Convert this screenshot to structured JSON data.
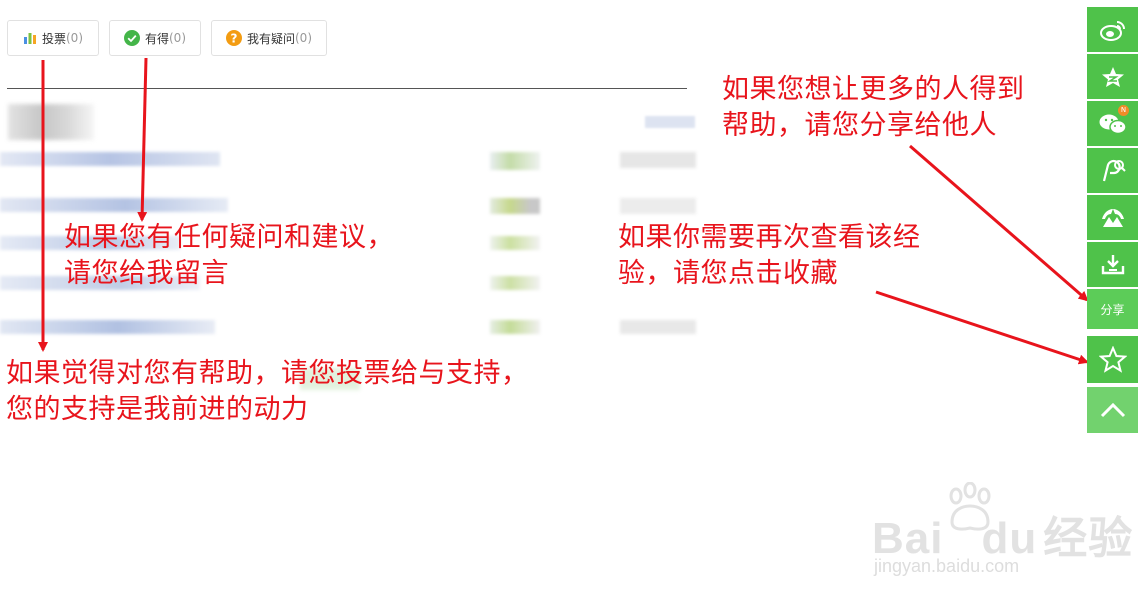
{
  "actions": {
    "vote": {
      "label": "投票",
      "count": "(0)"
    },
    "useful": {
      "label": "有得",
      "count": "(0)"
    },
    "question": {
      "label": "我有疑问",
      "count": "(0)"
    }
  },
  "annotations": {
    "comment": [
      "如果您有任何疑问和建议，",
      "请您给我留言"
    ],
    "vote": [
      "如果觉得对您有帮助，请您投票给与支持，",
      "您的支持是我前进的动力"
    ],
    "share": [
      "如果您想让更多的人得到",
      "帮助，请您分享给他人"
    ],
    "favorite": [
      "如果你需要再次查看该经",
      "验，请您点击收藏"
    ]
  },
  "sidebar": {
    "items": [
      {
        "icon": "weibo-icon"
      },
      {
        "icon": "qzone-icon"
      },
      {
        "icon": "wechat-icon",
        "badge": "N"
      },
      {
        "icon": "tieba-icon"
      },
      {
        "icon": "renren-icon"
      },
      {
        "icon": "douban-icon"
      }
    ],
    "share_label": "分享",
    "favorite_icon": "star-outline-icon",
    "top_icon": "chevron-up-icon"
  },
  "watermark": {
    "brand": "Bai",
    "brand_tail": "du",
    "product": "经验",
    "url": "jingyan.baidu.com"
  },
  "colors": {
    "annotation": "#e8141c",
    "sidebar": "#4fc24a",
    "button_border": "#e1e1e1"
  }
}
